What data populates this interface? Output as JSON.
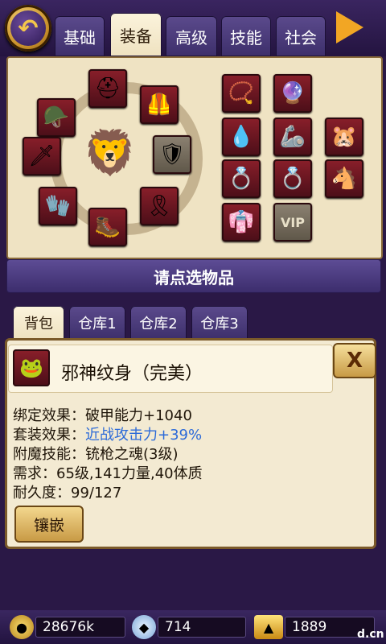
{
  "tabs": [
    {
      "label": "基础",
      "active": false
    },
    {
      "label": "装备",
      "active": true
    },
    {
      "label": "高级",
      "active": false
    },
    {
      "label": "技能",
      "active": false
    },
    {
      "label": "社会",
      "active": false
    }
  ],
  "equipment": {
    "left_slots": [
      "helmet-icon",
      "head-armor-icon",
      "shoulder-icon",
      "sword-icon",
      "empty-shield-icon",
      "glove-icon",
      "belt-icon",
      "boots-icon"
    ],
    "right_slots": [
      "necklace-icon",
      "amulet-icon",
      "pendant-icon",
      "bracer-icon",
      "pet-icon",
      "ring-icon",
      "ring-icon",
      "horse-icon",
      "tattoo-icon"
    ],
    "vip_label": "VIP"
  },
  "select_prompt": "请点选物品",
  "bag_tabs": [
    {
      "label": "背包",
      "active": true
    },
    {
      "label": "仓库1",
      "active": false
    },
    {
      "label": "仓库2",
      "active": false
    },
    {
      "label": "仓库3",
      "active": false
    }
  ],
  "item_detail": {
    "name": "邪神纹身（完美）",
    "lines": [
      {
        "label": "绑定效果：",
        "value": "破甲能力+1040"
      },
      {
        "label": "套装效果：",
        "value": "近战攻击力+39%"
      },
      {
        "label": "附魔技能：",
        "value": "铳枪之魂(3级)"
      },
      {
        "label": "需求：",
        "value": "65级,141力量,40体质"
      },
      {
        "label": "耐久度：",
        "value": "99/127"
      }
    ],
    "inlay_button": "镶嵌",
    "close_label": "X"
  },
  "resources": {
    "gold": "28676k",
    "gems": "714",
    "ingots": "1889"
  },
  "watermark": "d.cn"
}
